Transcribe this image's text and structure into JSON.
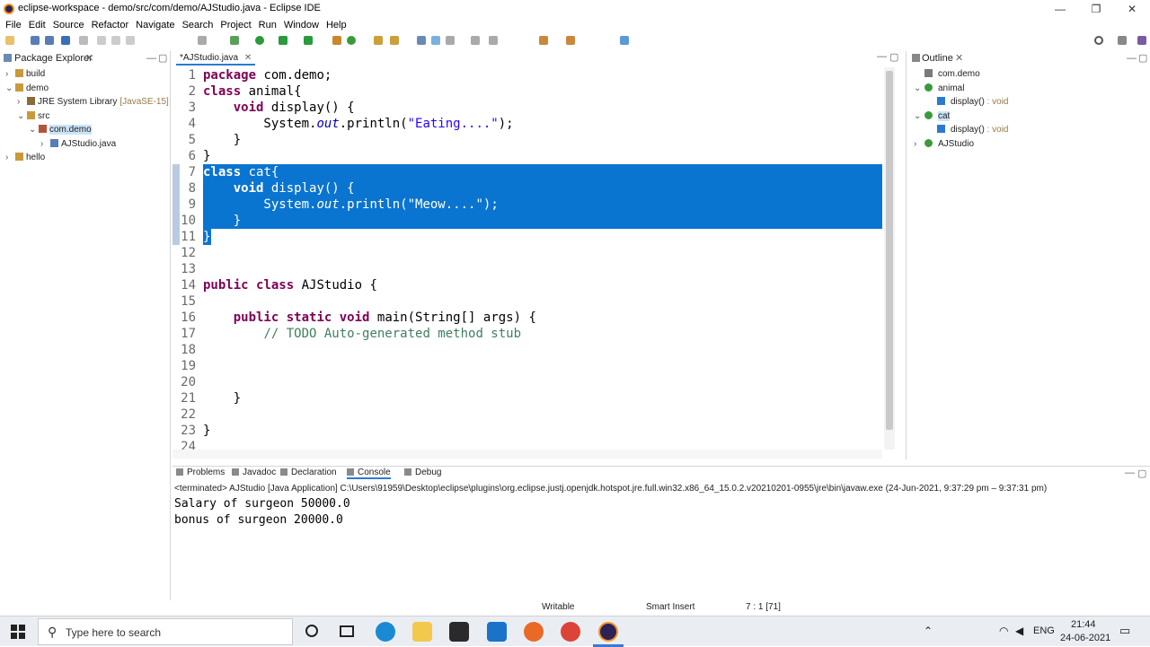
{
  "window": {
    "title": "eclipse-workspace - demo/src/com/demo/AJStudio.java - Eclipse IDE",
    "controls": [
      "—",
      "❐",
      "✕"
    ]
  },
  "menu": [
    "File",
    "Edit",
    "Source",
    "Refactor",
    "Navigate",
    "Search",
    "Project",
    "Run",
    "Window",
    "Help"
  ],
  "package_explorer": {
    "tab_label": "Package Explorer",
    "items": [
      {
        "label": "build",
        "depth": 0,
        "expanded": false,
        "icon": "project-icon"
      },
      {
        "label": "demo",
        "depth": 0,
        "expanded": true,
        "icon": "project-icon"
      },
      {
        "label": "JRE System Library",
        "extra": "[JavaSE-15]",
        "depth": 1,
        "expanded": false,
        "icon": "library-icon"
      },
      {
        "label": "src",
        "depth": 1,
        "expanded": true,
        "icon": "source-folder-icon"
      },
      {
        "label": "com.demo",
        "depth": 2,
        "expanded": true,
        "icon": "package-icon",
        "selected": true
      },
      {
        "label": "AJStudio.java",
        "depth": 3,
        "expanded": false,
        "icon": "java-file-icon"
      },
      {
        "label": "hello",
        "depth": 0,
        "expanded": false,
        "icon": "project-icon"
      }
    ]
  },
  "editor": {
    "tab_label": "*AJStudio.java",
    "lines": [
      {
        "n": "1",
        "tokens": [
          [
            "kw",
            "package"
          ],
          [
            "",
            " com.demo;"
          ]
        ]
      },
      {
        "n": "2",
        "tokens": [
          [
            "kw",
            "class"
          ],
          [
            "",
            " animal{"
          ]
        ]
      },
      {
        "n": "3",
        "tokens": [
          [
            "",
            "    "
          ],
          [
            "kw",
            "void"
          ],
          [
            "",
            " display() {"
          ]
        ]
      },
      {
        "n": "4",
        "tokens": [
          [
            "",
            "        System."
          ],
          [
            "fld",
            "out"
          ],
          [
            "",
            ".println("
          ],
          [
            "str",
            "\"Eating....\""
          ],
          [
            "",
            ");"
          ]
        ]
      },
      {
        "n": "5",
        "tokens": [
          [
            "",
            "    }"
          ]
        ]
      },
      {
        "n": "6",
        "tokens": [
          [
            "",
            "}"
          ]
        ]
      },
      {
        "n": "7",
        "tokens": [
          [
            "kw",
            "class"
          ],
          [
            "",
            " cat{"
          ]
        ],
        "highlight": true
      },
      {
        "n": "8",
        "tokens": [
          [
            "",
            "    "
          ],
          [
            "kw",
            "void"
          ],
          [
            "",
            " display() {"
          ]
        ],
        "highlight": true
      },
      {
        "n": "9",
        "tokens": [
          [
            "",
            "        System."
          ],
          [
            "fld",
            "out"
          ],
          [
            "",
            ".println("
          ],
          [
            "str",
            "\"Meow....\""
          ],
          [
            "",
            ");"
          ]
        ],
        "highlight": true
      },
      {
        "n": "10",
        "tokens": [
          [
            "",
            "    }"
          ]
        ],
        "highlight": true
      },
      {
        "n": "11",
        "tokens": [
          [
            "",
            "}"
          ]
        ],
        "highlight": true,
        "partial": true
      },
      {
        "n": "12",
        "tokens": []
      },
      {
        "n": "13",
        "tokens": []
      },
      {
        "n": "14",
        "tokens": [
          [
            "kw",
            "public"
          ],
          [
            "",
            " "
          ],
          [
            "kw",
            "class"
          ],
          [
            "",
            " AJStudio {"
          ]
        ]
      },
      {
        "n": "15",
        "tokens": []
      },
      {
        "n": "16",
        "tokens": [
          [
            "",
            "    "
          ],
          [
            "kw",
            "public"
          ],
          [
            "",
            " "
          ],
          [
            "kw",
            "static"
          ],
          [
            "",
            " "
          ],
          [
            "kw",
            "void"
          ],
          [
            "",
            " main(String[] args) {"
          ]
        ]
      },
      {
        "n": "17",
        "tokens": [
          [
            "",
            "        "
          ],
          [
            "cmt",
            "// TODO Auto-generated method stub"
          ]
        ]
      },
      {
        "n": "18",
        "tokens": []
      },
      {
        "n": "19",
        "tokens": []
      },
      {
        "n": "20",
        "tokens": []
      },
      {
        "n": "21",
        "tokens": [
          [
            "",
            "    }"
          ]
        ]
      },
      {
        "n": "22",
        "tokens": []
      },
      {
        "n": "23",
        "tokens": [
          [
            "",
            "}"
          ]
        ]
      },
      {
        "n": "24",
        "tokens": []
      }
    ]
  },
  "outline": {
    "tab_label": "Outline",
    "items": [
      {
        "label": "com.demo",
        "depth": 0,
        "icon": "package-icon"
      },
      {
        "label": "animal",
        "depth": 0,
        "expanded": true,
        "icon": "class-icon"
      },
      {
        "label": "display()",
        "suffix": " : void",
        "depth": 1,
        "icon": "method-default-icon"
      },
      {
        "label": "cat",
        "depth": 0,
        "expanded": true,
        "icon": "class-icon",
        "selected": true
      },
      {
        "label": "display()",
        "suffix": " : void",
        "depth": 1,
        "icon": "method-default-icon"
      },
      {
        "label": "AJStudio",
        "depth": 0,
        "expanded": false,
        "icon": "class-public-icon"
      }
    ]
  },
  "bottom_tabs": [
    "Problems",
    "Javadoc",
    "Declaration",
    "Console",
    "Debug"
  ],
  "console": {
    "header": "<terminated> AJStudio [Java Application] C:\\Users\\91959\\Desktop\\eclipse\\plugins\\org.eclipse.justj.openjdk.hotspot.jre.full.win32.x86_64_15.0.2.v20210201-0955\\jre\\bin\\javaw.exe  (24-Jun-2021, 9:37:29 pm – 9:37:31 pm)",
    "output": [
      "Salary of surgeon 50000.0",
      "bonus of surgeon 20000.0"
    ]
  },
  "status": {
    "writable": "Writable",
    "insert_mode": "Smart Insert",
    "position": "7 : 1 [71]"
  },
  "taskbar": {
    "search_placeholder": "Type here to search",
    "language": "ENG",
    "time": "21:44",
    "date": "24-06-2021"
  }
}
